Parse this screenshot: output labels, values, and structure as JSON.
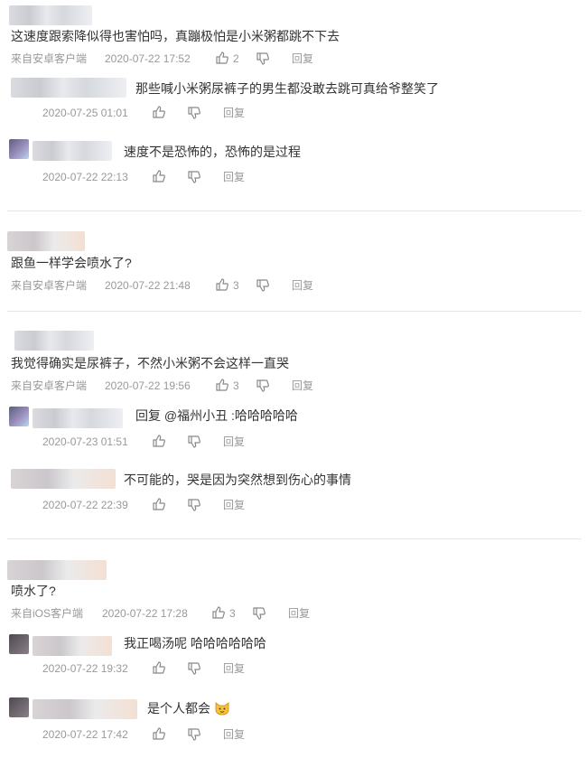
{
  "comments": [
    {
      "text": "这速度跟索降似得也害怕吗，真蹦极怕是小米粥都跳不下去",
      "source": "来自安卓客户端",
      "time": "2020-07-22 17:52",
      "likes": "2",
      "reply_label": "回复",
      "replies": [
        {
          "text": "那些喊小米粥尿裤子的男生都没敢去跳可真给爷整笑了",
          "time": "2020-07-25 01:01",
          "reply_label": "回复"
        },
        {
          "text": "速度不是恐怖的，恐怖的是过程",
          "time": "2020-07-22 22:13",
          "reply_label": "回复"
        }
      ]
    },
    {
      "text": "跟鱼一样学会喷水了?",
      "source": "来自安卓客户端",
      "time": "2020-07-22 21:48",
      "likes": "3",
      "reply_label": "回复",
      "replies": []
    },
    {
      "text": "我觉得确实是尿裤子，不然小米粥不会这样一直哭",
      "source": "来自安卓客户端",
      "time": "2020-07-22 19:56",
      "likes": "3",
      "reply_label": "回复",
      "replies": [
        {
          "prefix": "回复 ",
          "mention": "@福州小丑",
          "suffix": " :哈哈哈哈哈",
          "time": "2020-07-23 01:51",
          "reply_label": "回复"
        },
        {
          "text": "不可能的，哭是因为突然想到伤心的事情",
          "time": "2020-07-22 22:39",
          "reply_label": "回复"
        }
      ]
    },
    {
      "text": "喷水了?",
      "source": "来自iOS客户端",
      "time": "2020-07-22 17:28",
      "likes": "3",
      "reply_label": "回复",
      "replies": [
        {
          "text": "我正喝汤呢 哈哈哈哈哈哈",
          "time": "2020-07-22 19:32",
          "reply_label": "回复"
        },
        {
          "text": "是个人都会",
          "emoji": "cat-emoji",
          "time": "2020-07-22 17:42",
          "reply_label": "回复"
        }
      ]
    }
  ],
  "icons": {
    "like": "thumbs-up-icon",
    "dislike": "thumbs-down-icon"
  }
}
